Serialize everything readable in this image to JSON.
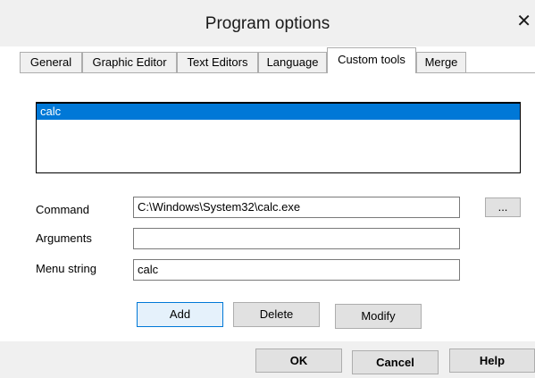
{
  "window": {
    "title": "Program options"
  },
  "tabs": [
    {
      "label": "General"
    },
    {
      "label": "Graphic Editor"
    },
    {
      "label": "Text Editors"
    },
    {
      "label": "Language"
    },
    {
      "label": "Custom tools"
    },
    {
      "label": "Merge"
    }
  ],
  "active_tab": "Custom tools",
  "tools_list": {
    "items": [
      "calc"
    ],
    "selected": "calc"
  },
  "form": {
    "command_label": "Command",
    "command_value": "C:\\Windows\\System32\\calc.exe",
    "browse_label": "...",
    "arguments_label": "Arguments",
    "arguments_value": "",
    "menu_string_label": "Menu string",
    "menu_string_value": "calc"
  },
  "actions": {
    "add": "Add",
    "delete": "Delete",
    "modify": "Modify"
  },
  "footer": {
    "ok": "OK",
    "cancel": "Cancel",
    "help": "Help"
  },
  "colors": {
    "selection": "#0078d7",
    "dialog_bg": "#f0f0f0",
    "panel_bg": "#ffffff"
  }
}
